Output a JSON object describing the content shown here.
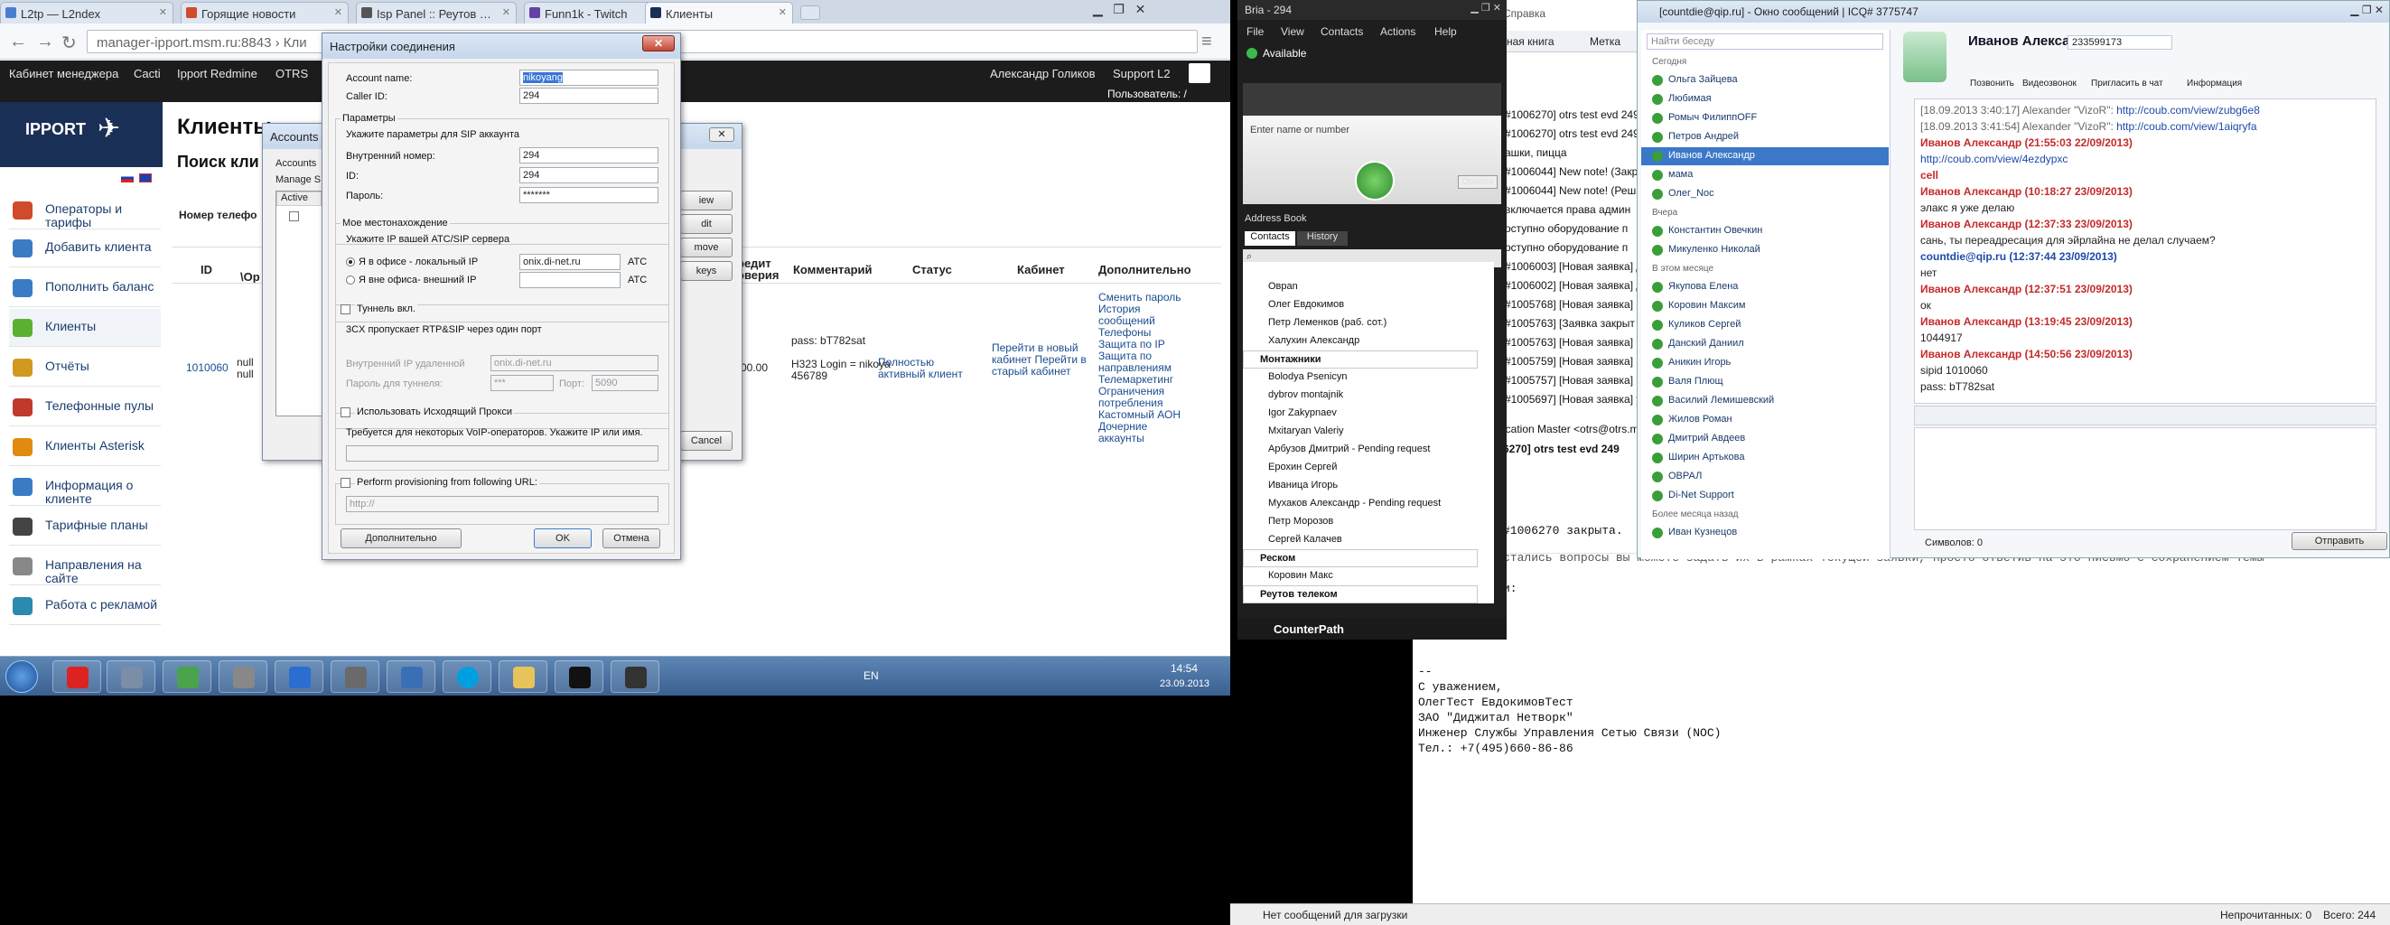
{
  "browser": {
    "tabs": [
      "L2tp — L2ndex",
      "Горящие новости",
      "Isp Panel :: Реутов :: 3...",
      "Funn1k - Twitch",
      "Клиенты"
    ],
    "url": "manager-ipport.msm.ru:8843 › Кли",
    "topmenu": [
      "Кабинет менеджера",
      "Cacti",
      "Ipport Redmine",
      "OTRS",
      "Александр Голиков",
      "Support L2"
    ],
    "user_label": "Пользователь: /"
  },
  "site": {
    "logo": "IPPORT",
    "page_title": "Клиенты",
    "search_title": "Поиск кли",
    "phone_label": "Номер телефо",
    "sidebar": [
      "Операторы и тарифы",
      "Добавить клиента",
      "Пополнить баланс",
      "Клиенты",
      "Отчёты",
      "Телефонные пулы",
      "Клиенты Asterisk",
      "Информация о клиенте",
      "Тарифные планы",
      "Направления на сайте",
      "Работа с рекламой"
    ],
    "sidebar_colors": [
      "#d04b2b",
      "#3a7cc4",
      "#3a7cc4",
      "#5bb030",
      "#d09a20",
      "#c0392b",
      "#e08a10",
      "#3a7cc4",
      "#444444",
      "#888888",
      "#2a8ab0"
    ],
    "columns": [
      "ID",
      "\\Op",
      "редит\nоверия",
      "Комментарий",
      "Статус",
      "Кабинет",
      "Дополнительно"
    ],
    "row": {
      "id": "1010060",
      "op": "null\nnull",
      "credit": "00.00",
      "comment": "pass: bT782sat\n\nH323 Login = nikoya 456789",
      "status": "Полностью активный клиент",
      "cabinet": "Перейти в новый кабинет Перейти в старый кабинет",
      "extra": "Сменить пароль История сообщений Телефоны Защита по IP Защита по направлениям Телемаркетинг Ограничения потребления Кастомный АОН Дочерние аккаунты"
    }
  },
  "accounts_dialog": {
    "title": "Accounts",
    "menu": "Accounts",
    "manage": "Manage S",
    "col": "Active",
    "buttons": [
      "iew",
      "dit",
      "move",
      "keys",
      "Cancel"
    ]
  },
  "conn_dialog": {
    "title": "Настройки соединения",
    "close": "✕",
    "account_name_label": "Account name:",
    "account_name": "nikoyang",
    "caller_id_label": "Caller ID:",
    "caller_id": "294",
    "params_title": "Параметры",
    "params_hint": "Укажите параметры для SIP аккаунта",
    "internal_label": "Внутренний номер:",
    "internal": "294",
    "id_label": "ID:",
    "id": "294",
    "pass_label": "Пароль:",
    "pass": "*******",
    "location_title": "Мое местонахождение",
    "location_hint": "Укажите IP вашей АТС/SIP сервера",
    "office_local": "Я в офисе - локальный IP",
    "office_local_val": "onix.di-net.ru",
    "office_ext": "Я вне офиса- внешний IP",
    "ats": "АТС",
    "tunnel_label": "Туннель вкл.",
    "tunnel_hint": "3CX пропускает RTP&SIP через один порт",
    "tunnel_ip_label": "Внутренний IP удаленной",
    "tunnel_ip": "onix.di-net.ru",
    "tunnel_pass_label": "Пароль для туннеля:",
    "tunnel_pass": "***",
    "port_label": "Порт:",
    "port": "5090",
    "proxy_label": "Использовать Исходящий Прокси",
    "proxy_hint": "Требуется для некоторых VoIP-операторов. Укажите IP или имя.",
    "prov_label": "Perform provisioning from following URL:",
    "prov_url": "http://",
    "advanced_btn": "Дополнительно",
    "ok_btn": "OK",
    "cancel_btn": "Отмена"
  },
  "taskbar": {
    "lang": "EN",
    "time": "14:54",
    "date": "23.09.2013"
  },
  "bria": {
    "title": "Bria - 294",
    "menu": [
      "File",
      "View",
      "Contacts",
      "Actions",
      "Help"
    ],
    "status": "Available",
    "input_placeholder": "Enter name or number",
    "options": "Options",
    "address_book": "Address Book",
    "tabs": [
      "Contacts",
      "History"
    ],
    "contacts": [
      {
        "t": "Овраn",
        "g": false
      },
      {
        "t": "Олег Евдокимов",
        "g": false
      },
      {
        "t": "Петр Леменков (раб. сот.)",
        "g": false
      },
      {
        "t": "Халухин Александр",
        "g": false
      },
      {
        "t": "Монтажники",
        "g": true
      },
      {
        "t": "Bolodya Psenicyn",
        "g": false
      },
      {
        "t": "dybrov montajnik",
        "g": false
      },
      {
        "t": "Igor Zakypnaev",
        "g": false
      },
      {
        "t": "Mxitaryan Valeriy",
        "g": false
      },
      {
        "t": "Арбузов Дмитрий - Pending request",
        "g": false
      },
      {
        "t": "Ерохин Сергей",
        "g": false
      },
      {
        "t": "Иваница Игорь",
        "g": false
      },
      {
        "t": "Мухаков Александр - Pending request",
        "g": false
      },
      {
        "t": "Петр Морозов",
        "g": false
      },
      {
        "t": "Сергей Калачев",
        "g": false
      },
      {
        "t": "Реском",
        "g": true
      },
      {
        "t": "Коровин Макс",
        "g": false
      },
      {
        "t": "Реутов телеком",
        "g": true
      }
    ],
    "brand": "CounterPath"
  },
  "mail": {
    "menu": [
      "Справка"
    ],
    "toolbar": [
      "ная книга",
      "Метка"
    ],
    "tickets": [
      "#1006270] otrs test evd 249",
      "#1006270] otrs test evd 249",
      "ашки, пицца",
      "#1006044] New note! (Закр",
      "#1006044] New note! (Реш",
      "включается права админ",
      "оступно оборудование п",
      "оступно оборудование п",
      "#1006003] [Новая заявка] Д",
      "#1006002] [Новая заявка] Д",
      "#1005768] [Новая заявка] С",
      "#1005763] [Заявка закрыт",
      "#1005763] [Новая заявка] [",
      "#1005759] [Новая заявка] [",
      "#1005757] [Новая заявка] [",
      "#1005697] [Новая заявка] у"
    ],
    "from": "ication Master <otrs@otrs.m",
    "subject": "6270] otrs test evd 249",
    "body_closed": "#1006270 закрыта.",
    "body_line": "стались вопросы вы можете задать их в рамках текущей заявки, просто ответив на это письмо с сохранением темы",
    "body_colon": "и:",
    "sig": [
      "--",
      "С уважением,",
      "ОлегТест ЕвдокимовТест",
      "ЗАО \"Диджитал Нетворк\"",
      "Инженер Службы Управления Сетью Связи (NOC)",
      "Тел.: +7(495)660-86-86"
    ],
    "status_left": "Нет сообщений для загрузки",
    "status_unread": "Непрочитанных: 0",
    "status_total": "Всего: 244"
  },
  "qip": {
    "title": "[countdie@qip.ru] - Окно сообщений | ICQ# 3775747",
    "search_placeholder": "Найти беседу",
    "contact_name": "Иванов Александр",
    "uin": "233599173",
    "actions": [
      "Позвонить",
      "Видеозвонок",
      "Пригласить в чат",
      "Информация"
    ],
    "groups": [
      {
        "name": "Сегодня",
        "items": [
          "Ольга Зайцева",
          "Любимая",
          "Ромыч ФилиппOFF",
          "Петров Андрей",
          "Иванов Александр",
          "мама",
          "Олег_Noc"
        ]
      },
      {
        "name": "Вчера",
        "items": [
          "Константин Овечкин",
          "Микуленко Николай"
        ]
      },
      {
        "name": "В этом месяце",
        "items": [
          "Якупова Елена",
          "Коровин Максим",
          "Куликов Сергей",
          "Данский Даниил",
          "Аникин Игорь",
          "Валя Плющ",
          "Василий Лемишевский",
          "Жилов Роман",
          "Дмитрий Авдеев",
          "Ширин Артькова",
          "ОВРАЛ",
          "Di-Net Support"
        ]
      },
      {
        "name": "Более месяца назад",
        "items": [
          "Иван Кузнецов"
        ]
      }
    ],
    "messages": [
      {
        "t": "[18.09.2013 3:40:17] Alexander \"VizoR\": ",
        "l": "http://coub.com/view/zubg6e8",
        "c": "gr"
      },
      {
        "t": "[18.09.2013 3:41:54] Alexander \"VizoR\": ",
        "l": "http://coub.com/view/1aiqryfa",
        "c": "gr"
      },
      {
        "t": "Иванов Александр (21:55:03 22/09/2013)",
        "l": "",
        "c": "red"
      },
      {
        "t": "",
        "l": "http://coub.com/view/4ezdypxc",
        "c": ""
      },
      {
        "t": "cell",
        "l": "",
        "c": "red"
      },
      {
        "t": "Иванов Александр (10:18:27 23/09/2013)",
        "l": "",
        "c": "red"
      },
      {
        "t": "элакс я уже делаю",
        "l": "",
        "c": ""
      },
      {
        "t": "Иванов Александр (12:37:33 23/09/2013)",
        "l": "",
        "c": "red"
      },
      {
        "t": "сань, ты переадресация для эйрлайна не делал случаем?",
        "l": "",
        "c": ""
      },
      {
        "t": "countdie@qip.ru (12:37:44 23/09/2013)",
        "l": "",
        "c": "blu"
      },
      {
        "t": "нет",
        "l": "",
        "c": ""
      },
      {
        "t": "Иванов Александр (12:37:51 23/09/2013)",
        "l": "",
        "c": "red"
      },
      {
        "t": "ок",
        "l": "",
        "c": ""
      },
      {
        "t": "Иванов Александр (13:19:45 23/09/2013)",
        "l": "",
        "c": "red"
      },
      {
        "t": "1044917",
        "l": "",
        "c": ""
      },
      {
        "t": "Иванов Александр (14:50:56 23/09/2013)",
        "l": "",
        "c": "red"
      },
      {
        "t": "sipid 1010060",
        "l": "",
        "c": ""
      },
      {
        "t": "pass: bT782sat",
        "l": "",
        "c": ""
      }
    ],
    "chars": "Символов: 0",
    "send": "Отправить"
  }
}
